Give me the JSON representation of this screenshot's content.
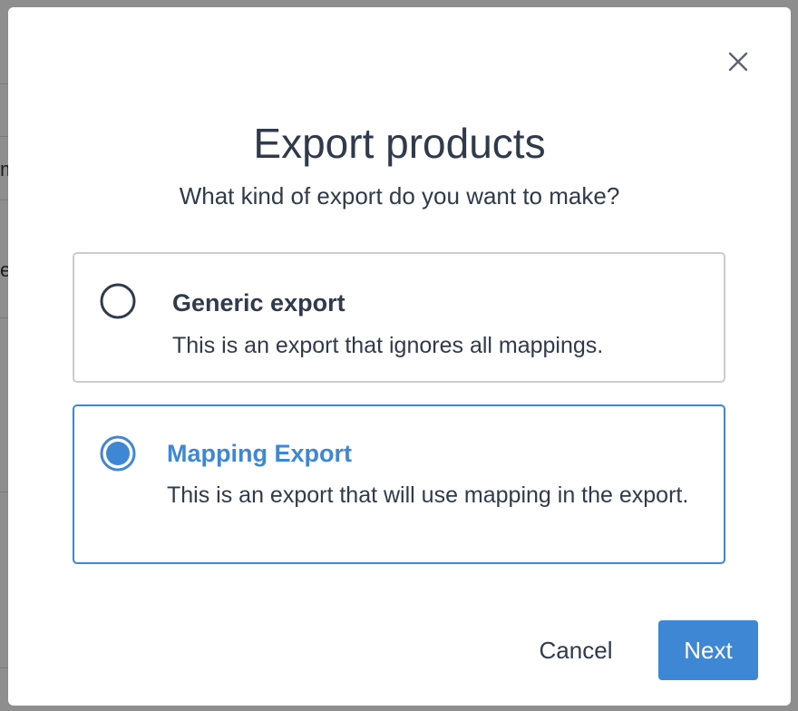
{
  "background": {
    "glyphs": [
      "m",
      "e"
    ]
  },
  "dialog": {
    "close_icon": "close-icon",
    "title": "Export products",
    "subtitle": "What kind of export do you want to make?",
    "options": [
      {
        "label": "Generic export",
        "description": "This is an export that ignores all mappings.",
        "selected": false
      },
      {
        "label": "Mapping Export",
        "description": "This is an export that will use mapping in the export.",
        "selected": true
      }
    ],
    "cancel_label": "Cancel",
    "next_label": "Next"
  },
  "colors": {
    "accent": "#3d87d4",
    "text": "#2f3a4a",
    "border": "#c9ccd1",
    "overlay": "#8e8e8e"
  }
}
